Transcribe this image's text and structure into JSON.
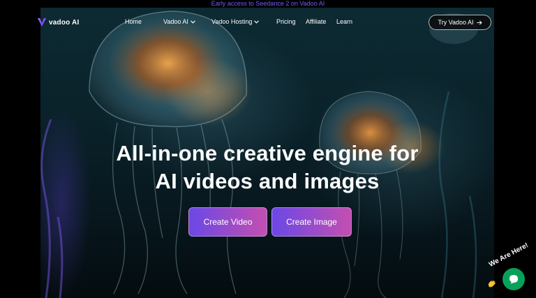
{
  "announcement": {
    "text": "Early access to Seedance 2 on Vadoo AI"
  },
  "nav": {
    "logo_text": "vadoo AI",
    "items": [
      {
        "label": "Home"
      },
      {
        "label": "Vadoo AI"
      },
      {
        "label": "Vadoo Hosting"
      },
      {
        "label": "Pricing"
      },
      {
        "label": "Affiliate"
      },
      {
        "label": "Learn"
      }
    ],
    "cta_label": "Try Vadoo AI"
  },
  "hero": {
    "headline_line1": "All-in-one creative engine for",
    "headline_line2": "AI videos and images",
    "create_video_label": "Create Video",
    "create_image_label": "Create Image"
  },
  "chat": {
    "label": "We Are Here!"
  },
  "colors": {
    "announcement_text": "#6f5cff",
    "button_gradient_start": "#6a48e6",
    "button_gradient_end": "#c44fb0",
    "chat_green": "#08a15a"
  },
  "icons": [
    "vadoo-logo-icon",
    "chevron-down-icon",
    "arrow-right-icon",
    "chat-bubble-icon",
    "waving-hand-icon"
  ]
}
